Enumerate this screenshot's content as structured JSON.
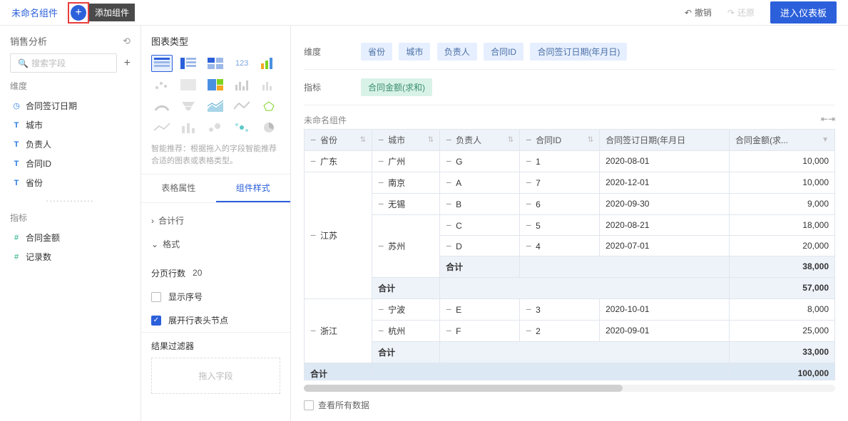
{
  "topbar": {
    "tab_name": "未命名组件",
    "tooltip": "添加组件",
    "undo": "撤销",
    "redo": "还原",
    "enter_dashboard": "进入仪表板"
  },
  "left": {
    "title": "销售分析",
    "search_placeholder": "搜索字段",
    "dim_label": "维度",
    "metric_label": "指标",
    "dims": [
      "合同签订日期",
      "城市",
      "负责人",
      "合同ID",
      "省份"
    ],
    "metrics": [
      "合同金额",
      "记录数"
    ]
  },
  "mid": {
    "chart_type_title": "图表类型",
    "hint": "智能推荐：根据拖入的字段智能推荐合适的图表或表格类型。",
    "tab1": "表格属性",
    "tab2": "组件样式",
    "prop_total": "合计行",
    "prop_format": "格式",
    "page_rows_label": "分页行数",
    "page_rows_value": "20",
    "show_seq": "显示序号",
    "expand_header": "展开行表头节点",
    "filter_title": "结果过滤器",
    "filter_placeholder": "拖入字段"
  },
  "right": {
    "dim_label": "维度",
    "metric_label": "指标",
    "dim_tags": [
      "省份",
      "城市",
      "负责人",
      "合同ID",
      "合同签订日期(年月日)"
    ],
    "metric_tags": [
      "合同金额(求和)"
    ],
    "component_name": "未命名组件",
    "columns": [
      "省份",
      "城市",
      "负责人",
      "合同ID",
      "合同签订日期(年月日",
      "合同金额(求..."
    ],
    "total_label": "合计",
    "view_all": "查看所有数据"
  },
  "chart_data": {
    "type": "table",
    "columns": [
      "省份",
      "城市",
      "负责人",
      "合同ID",
      "合同签订日期",
      "合同金额"
    ],
    "rows": [
      {
        "province": "广东",
        "city": "广州",
        "owner": "G",
        "id": "1",
        "date": "2020-08-01",
        "amount": 10000
      },
      {
        "province": "江苏",
        "city": "南京",
        "owner": "A",
        "id": "7",
        "date": "2020-12-01",
        "amount": 10000
      },
      {
        "province": "江苏",
        "city": "无锡",
        "owner": "B",
        "id": "6",
        "date": "2020-09-30",
        "amount": 9000
      },
      {
        "province": "江苏",
        "city": "苏州",
        "owner": "C",
        "id": "5",
        "date": "2020-08-21",
        "amount": 18000
      },
      {
        "province": "江苏",
        "city": "苏州",
        "owner": "D",
        "id": "4",
        "date": "2020-07-01",
        "amount": 20000
      },
      {
        "province": "浙江",
        "city": "宁波",
        "owner": "E",
        "id": "3",
        "date": "2020-10-01",
        "amount": 8000
      },
      {
        "province": "浙江",
        "city": "杭州",
        "owner": "F",
        "id": "2",
        "date": "2020-09-01",
        "amount": 25000
      }
    ],
    "subtotals": {
      "江苏_苏州": 38000,
      "江苏": 57000,
      "浙江": 33000
    },
    "grand_total": 100000
  }
}
